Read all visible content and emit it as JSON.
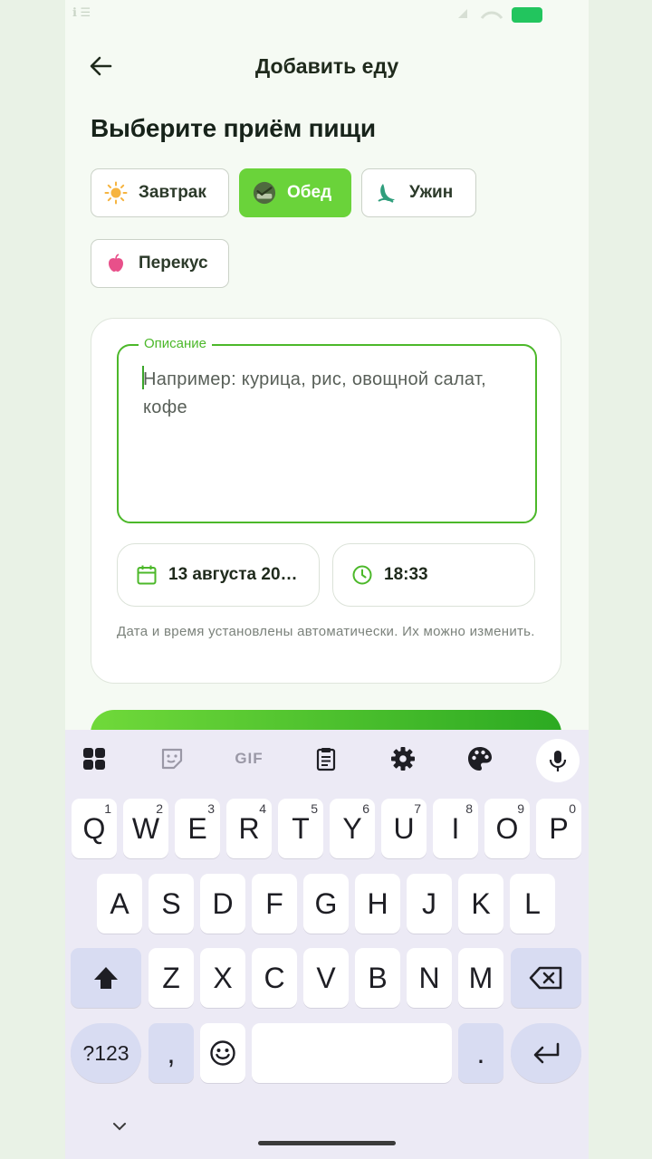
{
  "status": {
    "left_text": "ℹ ☰"
  },
  "appbar": {
    "title": "Добавить еду"
  },
  "section_title": "Выберите приём пищи",
  "meals": [
    {
      "label": "Завтрак",
      "icon": "sun-icon",
      "selected": false
    },
    {
      "label": "Обед",
      "icon": "lunch-icon",
      "selected": true
    },
    {
      "label": "Ужин",
      "icon": "moon-icon",
      "selected": false
    },
    {
      "label": "Перекус",
      "icon": "apple-icon",
      "selected": false
    }
  ],
  "description": {
    "label": "Описание",
    "placeholder": "Например: курица, рис, овощной салат, кофе"
  },
  "date": {
    "value": "13 августа 20…",
    "icon": "calendar-icon"
  },
  "time": {
    "value": "18:33",
    "icon": "clock-icon"
  },
  "hint": "Дата и время установлены автоматически. Их можно изменить.",
  "colors": {
    "accent": "#6ad33a",
    "accent_dark": "#4cb82a",
    "keyboard_bg": "#eceaf5"
  },
  "keyboard": {
    "toolbar": [
      "apps-icon",
      "sticker-icon",
      "gif-icon",
      "clipboard-icon",
      "settings-icon",
      "palette-icon",
      "mic-icon"
    ],
    "gif_label": "GIF",
    "row1": [
      {
        "k": "Q",
        "n": "1"
      },
      {
        "k": "W",
        "n": "2"
      },
      {
        "k": "E",
        "n": "3"
      },
      {
        "k": "R",
        "n": "4"
      },
      {
        "k": "T",
        "n": "5"
      },
      {
        "k": "Y",
        "n": "6"
      },
      {
        "k": "U",
        "n": "7"
      },
      {
        "k": "I",
        "n": "8"
      },
      {
        "k": "O",
        "n": "9"
      },
      {
        "k": "P",
        "n": "0"
      }
    ],
    "row2": [
      "A",
      "S",
      "D",
      "F",
      "G",
      "H",
      "J",
      "K",
      "L"
    ],
    "row3": [
      "Z",
      "X",
      "C",
      "V",
      "B",
      "N",
      "M"
    ],
    "symbols_label": "?123",
    "comma": ",",
    "period": "."
  }
}
